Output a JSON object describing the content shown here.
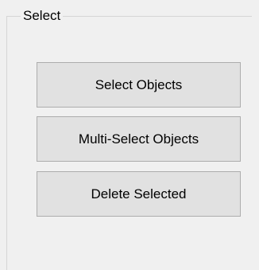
{
  "groupbox": {
    "title": "Select"
  },
  "buttons": {
    "select_objects": "Select Objects",
    "multi_select_objects": "Multi-Select Objects",
    "delete_selected": "Delete Selected"
  }
}
